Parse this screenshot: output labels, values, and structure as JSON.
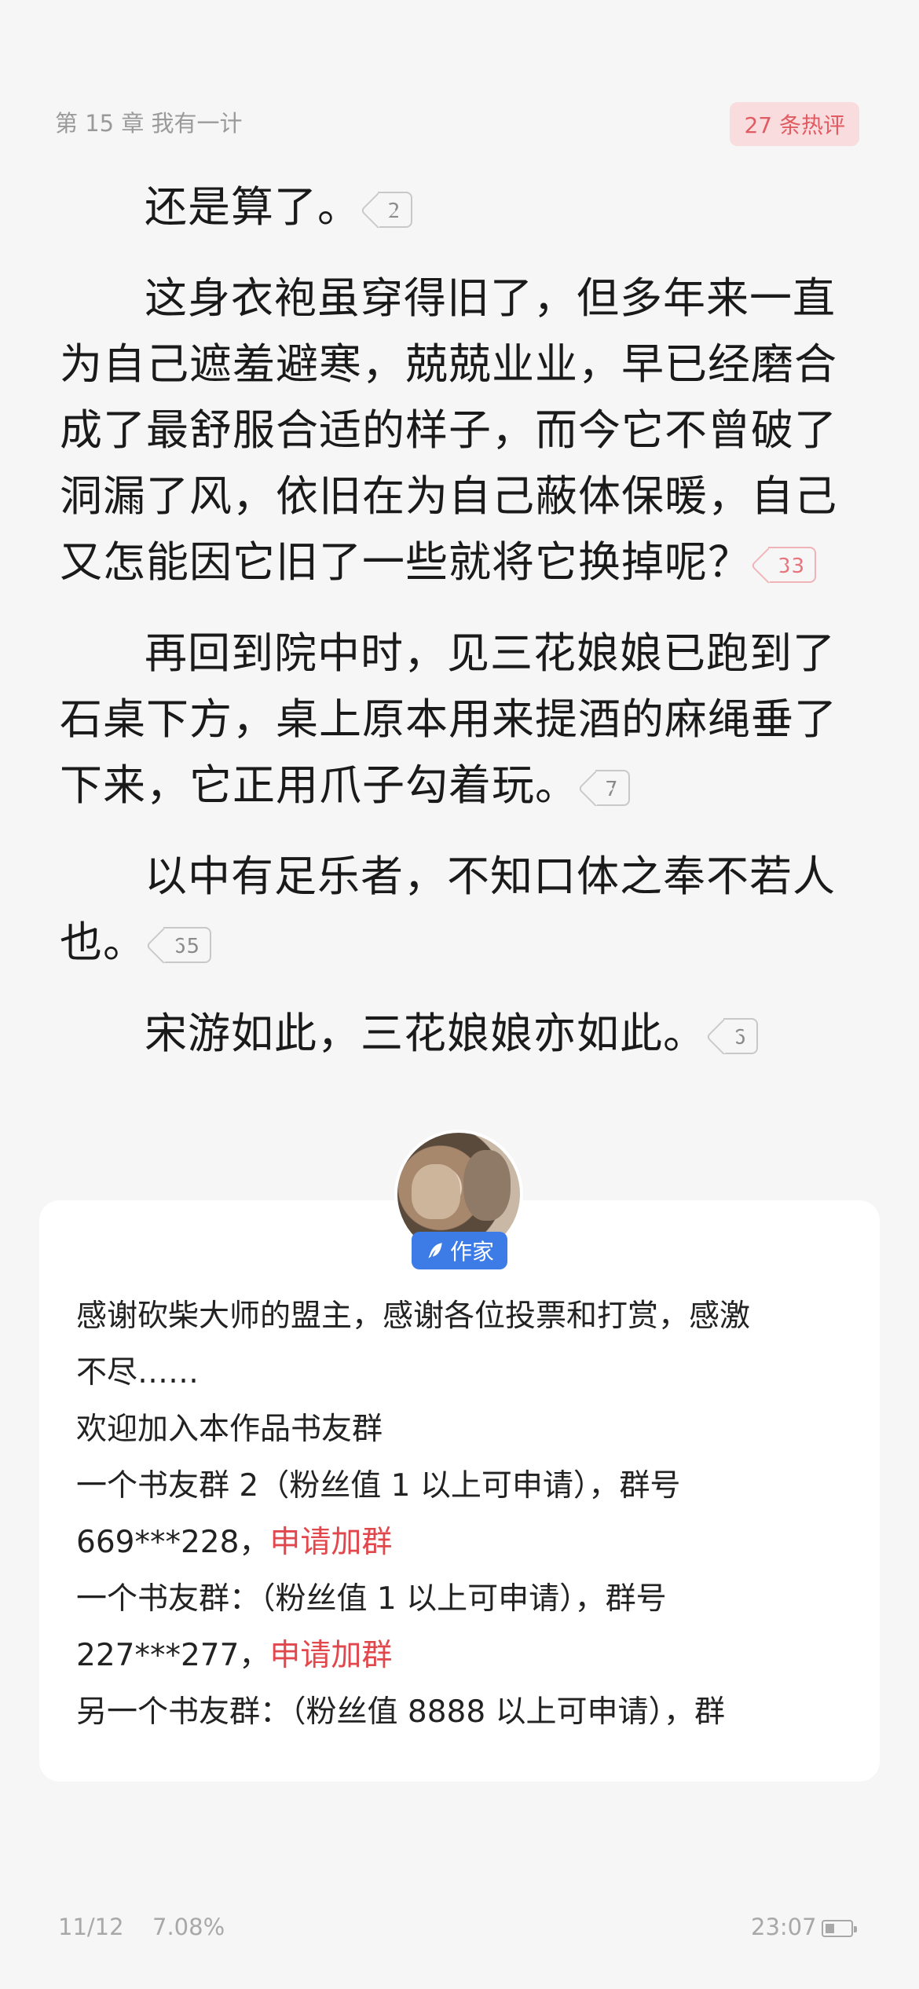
{
  "header": {
    "chapter_title": "第 15 章 我有一计",
    "hot_comments": "27 条热评"
  },
  "paragraphs": [
    {
      "text": "还是算了。",
      "comments": "2",
      "hot": false
    },
    {
      "text": "这身衣袍虽穿得旧了，但多年来一直为自己遮羞避寒，兢兢业业，早已经磨合成了最舒服合适的样子，而今它不曾破了洞漏了风，依旧在为自己蔽体保暖，自己又怎能因它旧了一些就将它换掉呢？",
      "comments": "33",
      "hot": true
    },
    {
      "text": "再回到院中时，见三花娘娘已跑到了石桌下方，桌上原本用来提酒的麻绳垂了下来，它正用爪子勾着玩。",
      "comments": "7",
      "hot": false
    },
    {
      "text": "以中有足乐者，不知口体之奉不若人也。",
      "comments": "65",
      "hot": false
    },
    {
      "text": "宋游如此，三花娘娘亦如此。",
      "comments": "6",
      "hot": false
    }
  ],
  "author": {
    "tag": "作家",
    "line1": "感谢砍柴大师的盟主，感谢各位投票和打赏，感激",
    "line2": "不尽……",
    "line3": "欢迎加入本作品书友群",
    "line4": "一个书友群 2（粉丝值 1 以上可申请），群号",
    "line5_number": "669***228，",
    "line5_link": "申请加群",
    "line6": "一个书友群：（粉丝值 1 以上可申请），群号",
    "line7_number": "227***277，",
    "line7_link": "申请加群",
    "line8": "另一个书友群：（粉丝值 8888 以上可申请），群"
  },
  "footer": {
    "page": "11/12",
    "progress": "7.08%",
    "time": "23:07",
    "battery_level": 0.35
  },
  "colors": {
    "accent_red": "#e0484e",
    "author_blue": "#3d7be6"
  }
}
